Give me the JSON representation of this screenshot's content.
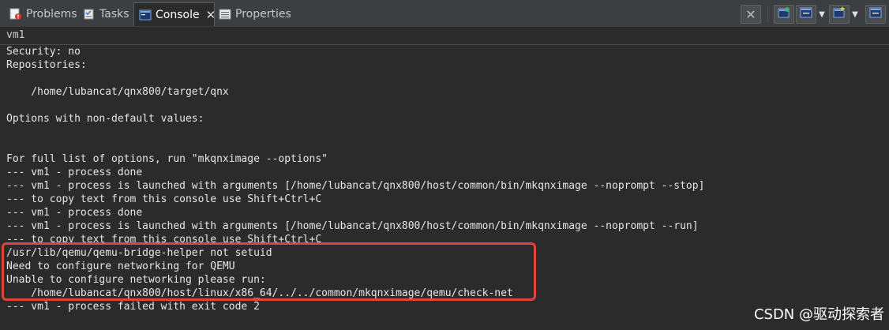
{
  "tabs": [
    {
      "label": "Problems",
      "icon": "problems-icon"
    },
    {
      "label": "Tasks",
      "icon": "tasks-icon"
    },
    {
      "label": "Console",
      "icon": "console-icon",
      "active": true
    },
    {
      "label": "Properties",
      "icon": "properties-icon"
    }
  ],
  "toolbar": {
    "buttons": [
      "terminate-icon",
      "display-selected-console-icon",
      "pin-console-icon",
      "open-console-icon",
      "minimize-icon"
    ]
  },
  "console": {
    "name": "vm1",
    "lines": [
      "Security: no",
      "Repositories:",
      "",
      "    /home/lubancat/qnx800/target/qnx",
      "",
      "Options with non-default values:",
      "",
      "",
      "For full list of options, run \"mkqnximage --options\"",
      "--- vm1 - process done",
      "--- vm1 - process is launched with arguments [/home/lubancat/qnx800/host/common/bin/mkqnximage --noprompt --stop]",
      "--- to copy text from this console use Shift+Ctrl+C",
      "--- vm1 - process done",
      "--- vm1 - process is launched with arguments [/home/lubancat/qnx800/host/common/bin/mkqnximage --noprompt --run]",
      "--- to copy text from this console use Shift+Ctrl+C",
      "/usr/lib/qemu/qemu-bridge-helper not setuid",
      "Need to configure networking for QEMU",
      "Unable to configure networking please run:",
      "    /home/lubancat/qnx800/host/linux/x86_64/../../common/mkqnximage/qemu/check-net",
      "--- vm1 - process failed with exit code 2"
    ]
  },
  "watermark": "CSDN @驱动探索者",
  "colors": {
    "highlight": "#e0443e",
    "background": "#2b2b2b"
  }
}
